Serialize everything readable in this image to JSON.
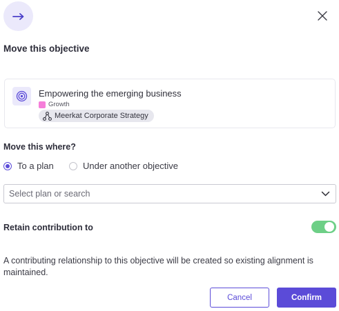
{
  "dialog": {
    "title": "Move this objective",
    "close_icon": "close-icon",
    "header_icon": "arrow-right-icon",
    "accent_color": "#5b4bd8"
  },
  "objective": {
    "icon": "target-icon",
    "title": "Empowering the emerging business",
    "tag": {
      "label": "Growth",
      "color": "#f57ed9"
    },
    "plan": {
      "icon": "hierarchy-icon",
      "label": "Meerkat Corporate Strategy"
    }
  },
  "move_where": {
    "label": "Move this where?",
    "options": [
      {
        "label": "To a plan",
        "selected": true
      },
      {
        "label": "Under another objective",
        "selected": false
      }
    ]
  },
  "select": {
    "placeholder": "Select plan or search",
    "icon": "chevron-down-icon"
  },
  "retain": {
    "label": "Retain contribution to",
    "enabled": true,
    "toggle_color": "#6dcf86"
  },
  "info_text": "A contributing relationship to this objective will be created so existing alignment is maintained.",
  "buttons": {
    "cancel": "Cancel",
    "confirm": "Confirm"
  }
}
